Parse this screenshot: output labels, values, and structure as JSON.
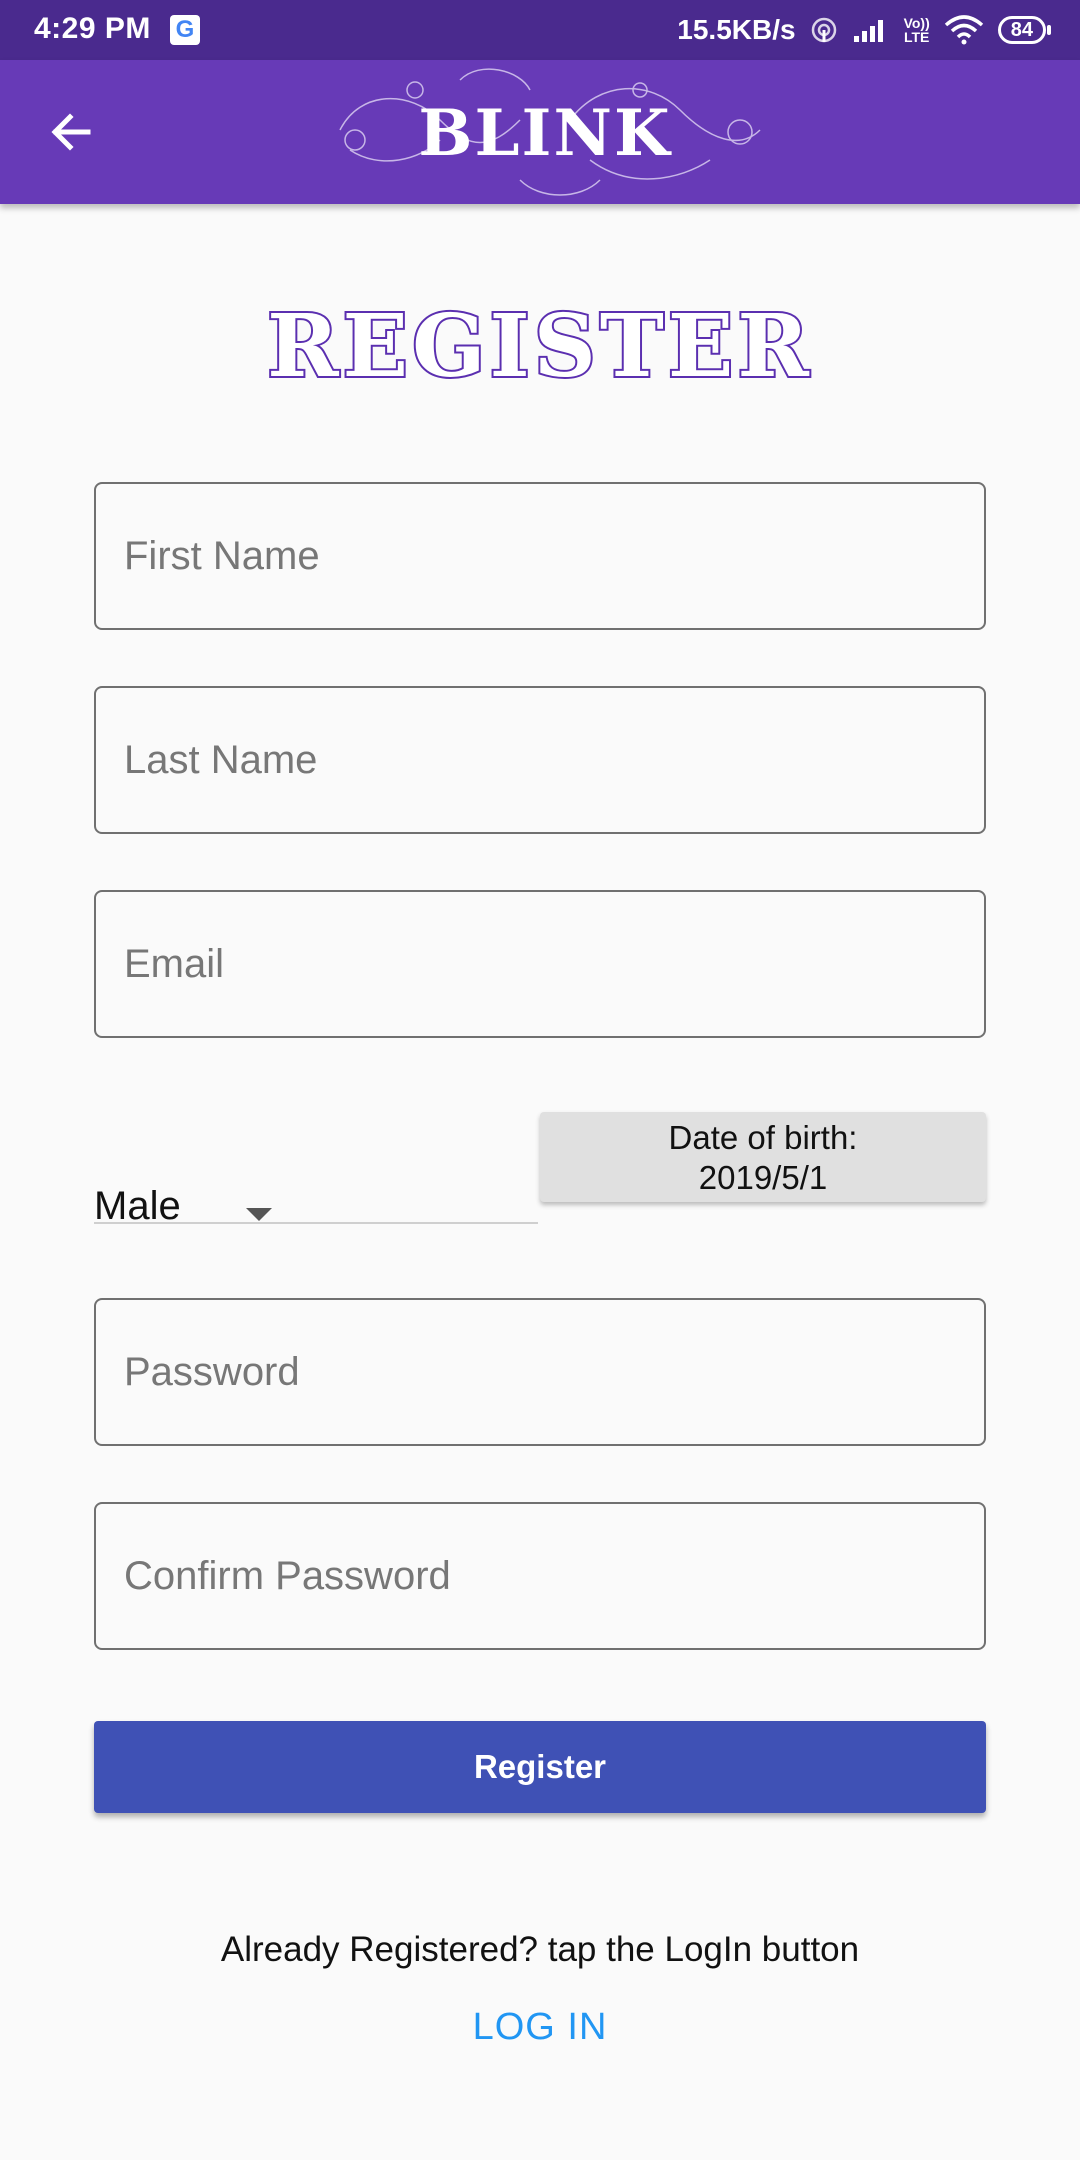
{
  "status_bar": {
    "time": "4:29 PM",
    "g_label": "G",
    "net_speed": "15.5KB/s",
    "volte_top": "Vo))",
    "volte_bottom": "LTE",
    "battery": "84"
  },
  "app_bar": {
    "logo": "BLINK",
    "back_icon": "arrow-left-icon"
  },
  "page": {
    "heading": "REGISTER"
  },
  "form": {
    "first_name_placeholder": "First Name",
    "last_name_placeholder": "Last Name",
    "email_placeholder": "Email",
    "gender_value": "Male",
    "dob_label": "Date of birth:",
    "dob_value": "2019/5/1",
    "password_placeholder": "Password",
    "confirm_password_placeholder": "Confirm Password",
    "register_label": "Register"
  },
  "footer": {
    "already_text": "Already Registered? tap the LogIn button",
    "login_label": "LOG IN"
  },
  "colors": {
    "status_bar": "#4a2a8e",
    "app_bar": "#673ab7",
    "register_button": "#3f51b5",
    "login_link": "#2196f3"
  }
}
